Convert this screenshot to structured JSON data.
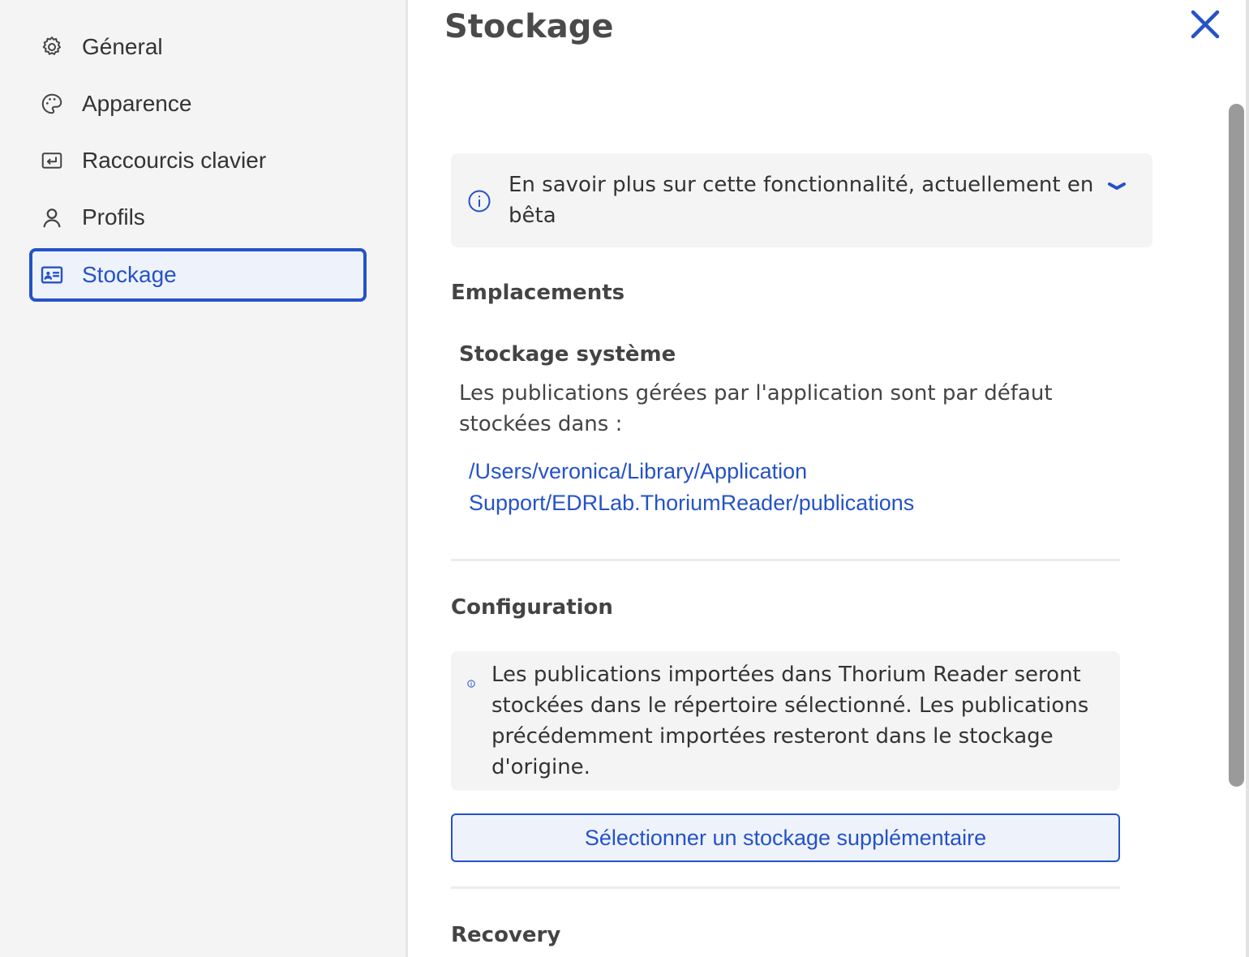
{
  "sidebar": {
    "items": [
      {
        "label": "Géneral",
        "icon": "gear-icon"
      },
      {
        "label": "Apparence",
        "icon": "palette-icon"
      },
      {
        "label": "Raccourcis clavier",
        "icon": "keyboard-return-icon"
      },
      {
        "label": "Profils",
        "icon": "user-icon"
      },
      {
        "label": "Stockage",
        "icon": "id-card-icon",
        "active": true
      }
    ]
  },
  "header": {
    "title": "Stockage",
    "close_icon": "close-icon"
  },
  "beta_notice": {
    "text": "En savoir plus sur cette fonctionnalité, actuellement en bêta",
    "icon": "info-icon",
    "toggle_icon": "chevron-down-icon"
  },
  "locations": {
    "heading": "Emplacements",
    "system_storage": {
      "title": "Stockage système",
      "description": "Les publications gérées par l'application sont par défaut stockées dans :",
      "path": "/Users/veronica/Library/Application Support/EDRLab.ThoriumReader/publications"
    }
  },
  "configuration": {
    "heading": "Configuration",
    "note": "Les publications importées dans Thorium Reader seront stockées dans le répertoire sélectionné. Les publications précédemment importées resteront dans le stockage d'origine.",
    "note_icon": "info-icon",
    "button_label": "Sélectionner un stockage supplémentaire"
  },
  "recovery": {
    "heading": "Recovery"
  },
  "colors": {
    "accent": "#2552c6",
    "sidebar_bg": "#f4f4f4",
    "panel_bg": "#f4f4f4",
    "text": "#333333"
  }
}
